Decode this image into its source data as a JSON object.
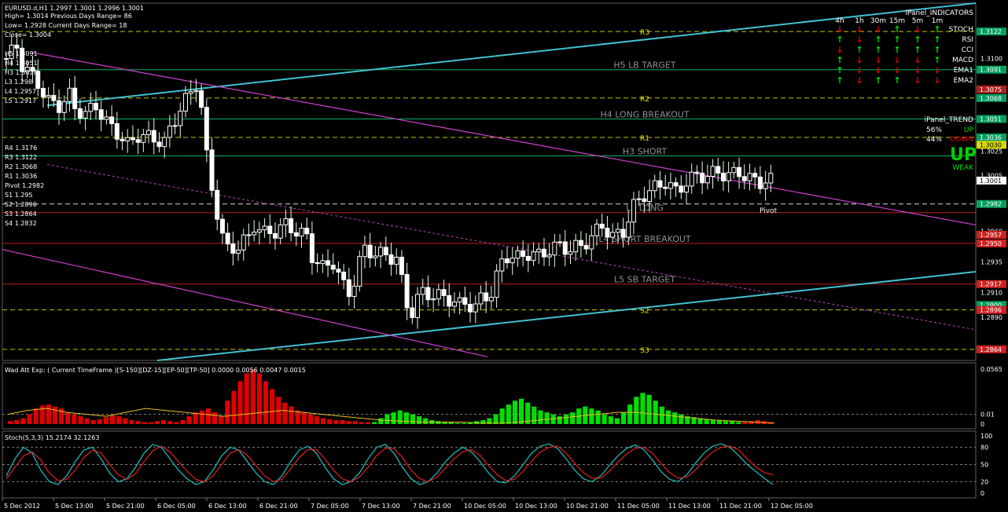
{
  "chart_data": [
    {
      "type": "candlestick",
      "symbol_line": "EURUSD.d,H1  1.2997 1.3001 1.2996 1.3001",
      "info_lines": [
        "High= 1.3014    Previous Days Range= 86",
        "Low= 1.2928    Current Days Range= 18",
        "Close= 1.3004"
      ],
      "ylim": [
        1.2855,
        1.3145
      ],
      "y_ticks": [
        "1.3122",
        "1.3100",
        "1.3075",
        "1.3051",
        "1.3025",
        "1.3005",
        "1.3001",
        "1.2960",
        "1.2935",
        "1.2910",
        "1.2890",
        "1.2864"
      ],
      "close_path": [
        [
          0,
          1.31
        ],
        [
          2,
          1.311
        ],
        [
          3,
          1.3095
        ],
        [
          6,
          1.308
        ],
        [
          8,
          1.3065
        ],
        [
          10,
          1.3062
        ],
        [
          12,
          1.307
        ],
        [
          13,
          1.306
        ],
        [
          15,
          1.3055
        ],
        [
          17,
          1.3062
        ],
        [
          19,
          1.3048
        ],
        [
          21,
          1.304
        ],
        [
          23,
          1.303
        ],
        [
          25,
          1.3038
        ],
        [
          28,
          1.3035
        ],
        [
          30,
          1.3032
        ],
        [
          33,
          1.306
        ],
        [
          35,
          1.3072
        ],
        [
          36,
          1.308
        ],
        [
          37,
          1.306
        ],
        [
          38,
          1.302
        ],
        [
          39,
          1.2995
        ],
        [
          40,
          1.2975
        ],
        [
          41,
          1.2955
        ],
        [
          42,
          1.2945
        ],
        [
          44,
          1.2948
        ],
        [
          46,
          1.2955
        ],
        [
          47,
          1.2965
        ],
        [
          49,
          1.2958
        ],
        [
          51,
          1.296
        ],
        [
          53,
          1.2965
        ],
        [
          55,
          1.296
        ],
        [
          57,
          1.2955
        ],
        [
          58,
          1.294
        ],
        [
          60,
          1.293
        ],
        [
          62,
          1.2935
        ],
        [
          63,
          1.2925
        ],
        [
          64,
          1.2915
        ],
        [
          65,
          1.291
        ],
        [
          66,
          1.292
        ],
        [
          67,
          1.2935
        ],
        [
          68,
          1.2945
        ],
        [
          70,
          1.2942
        ],
        [
          72,
          1.294
        ],
        [
          74,
          1.2938
        ],
        [
          76,
          1.29
        ],
        [
          77,
          1.2895
        ],
        [
          78,
          1.2905
        ],
        [
          79,
          1.291
        ],
        [
          81,
          1.2908
        ],
        [
          84,
          1.2905
        ],
        [
          86,
          1.29
        ],
        [
          87,
          1.2902
        ],
        [
          89,
          1.2898
        ],
        [
          90,
          1.2905
        ],
        [
          92,
          1.291
        ],
        [
          94,
          1.2935
        ],
        [
          95,
          1.294
        ],
        [
          97,
          1.2938
        ],
        [
          99,
          1.2942
        ],
        [
          101,
          1.294
        ],
        [
          103,
          1.2945
        ],
        [
          105,
          1.2948
        ],
        [
          107,
          1.2945
        ],
        [
          109,
          1.2948
        ],
        [
          111,
          1.2955
        ],
        [
          113,
          1.2965
        ],
        [
          115,
          1.2955
        ],
        [
          117,
          1.296
        ],
        [
          119,
          1.298
        ],
        [
          121,
          1.299
        ],
        [
          123,
          1.2995
        ],
        [
          125,
          1.3
        ],
        [
          127,
          1.2992
        ],
        [
          129,
          1.3
        ],
        [
          131,
          1.3005
        ],
        [
          133,
          1.3005
        ],
        [
          135,
          1.3008
        ],
        [
          137,
          1.3005
        ],
        [
          139,
          1.3008
        ],
        [
          141,
          1.3002
        ],
        [
          143,
          1.3
        ],
        [
          145,
          1.3001
        ]
      ],
      "levels": [
        {
          "label": "H5 LB TARGET",
          "value": 1.3091,
          "color": "#00d070"
        },
        {
          "label": "R2",
          "value": 1.3068,
          "color": "#e8e800"
        },
        {
          "label": "H4 LONG BREAKOUT",
          "value": 1.3051,
          "color": "#00d070"
        },
        {
          "label": "R1",
          "value": 1.3036,
          "color": "#e8e800"
        },
        {
          "label": "H3 SHORT",
          "value": 1.3021,
          "color": "#00d070"
        },
        {
          "label": "Pivot",
          "value": 1.2982,
          "color": "#ffffff"
        },
        {
          "label": "L3 LONG",
          "value": 1.2975,
          "color": "#e02020"
        },
        {
          "label": "L4 SHORT BREAKOUT",
          "value": 1.295,
          "color": "#e02020"
        },
        {
          "label": "L5 SB TARGET",
          "value": 1.2917,
          "color": "#e02020"
        },
        {
          "label": "S2",
          "value": 1.2896,
          "color": "#e8e800"
        },
        {
          "label": "R3",
          "value": 1.3122,
          "color": "#e8e800"
        },
        {
          "label": "S3",
          "value": 1.2864,
          "color": "#e8e800"
        }
      ],
      "left_levels": [
        "H5 1.3091",
        "H4 1.3051",
        "H3 1.3028",
        "L3 1.298",
        "L4 1.2957",
        "L5 1.2917",
        "R4 1.3176",
        "R3 1.3122",
        "R2 1.3068",
        "R1 1.3036",
        "Pivot 1.2982",
        "S1 1.295",
        "S2 1.2896",
        "S3 1.2864",
        "S4 1.2832"
      ],
      "price_tags": [
        {
          "text": "1.3122",
          "bg": "#00a060"
        },
        {
          "text": "1.3091",
          "bg": "#00a060"
        },
        {
          "text": "1.3075",
          "bg": "#b02020"
        },
        {
          "text": "1.3068",
          "bg": "#00a060"
        },
        {
          "text": "1.3051",
          "bg": "#00a060"
        },
        {
          "text": "1.3036",
          "bg": "#00a060"
        },
        {
          "text": "1.3030",
          "bg": "#d8d800"
        },
        {
          "text": "1.3001",
          "bg": "#ffffff"
        },
        {
          "text": "1.2982",
          "bg": "#00a060"
        },
        {
          "text": "1.2957",
          "bg": "#d02020"
        },
        {
          "text": "1.2950",
          "bg": "#d02020"
        },
        {
          "text": "1.2917",
          "bg": "#d02020"
        },
        {
          "text": "1.2900",
          "bg": "#00a060"
        },
        {
          "text": "1.2896",
          "bg": "#d02020"
        },
        {
          "text": "1.2864",
          "bg": "#d02020"
        }
      ],
      "x_ticks": [
        "5 Dec 2012",
        "5 Dec 13:00",
        "5 Dec 21:00",
        "6 Dec 05:00",
        "6 Dec 13:00",
        "6 Dec 21:00",
        "7 Dec 05:00",
        "7 Dec 13:00",
        "7 Dec 21:00",
        "10 Dec 05:00",
        "10 Dec 13:00",
        "10 Dec 21:00",
        "11 Dec 05:00",
        "11 Dec 13:00",
        "11 Dec 21:00",
        "12 Dec 05:00"
      ],
      "pivot_label": "Pivot"
    },
    {
      "type": "bar",
      "title": "Wad Att Exp: ( Current TimeFrame )[S-150][DZ-15][EP-50][TP-50] 0.0000 0.0056 0.0047 0.0015",
      "y_ticks": [
        "0.0565",
        "0.01",
        "0"
      ],
      "ylim": [
        0,
        0.0565
      ],
      "values": [
        -0.003,
        -0.004,
        -0.006,
        -0.01,
        -0.016,
        -0.019,
        -0.02,
        -0.018,
        -0.016,
        -0.012,
        -0.01,
        -0.008,
        -0.006,
        -0.004,
        -0.005,
        -0.007,
        -0.009,
        -0.008,
        -0.006,
        -0.004,
        -0.003,
        -0.002,
        -0.002,
        -0.003,
        -0.004,
        -0.003,
        -0.002,
        -0.004,
        -0.008,
        -0.012,
        -0.014,
        -0.016,
        -0.012,
        -0.008,
        -0.024,
        -0.034,
        -0.044,
        -0.052,
        -0.056,
        -0.052,
        -0.044,
        -0.036,
        -0.028,
        -0.022,
        -0.018,
        -0.014,
        -0.012,
        -0.01,
        -0.008,
        -0.006,
        -0.005,
        -0.004,
        -0.004,
        -0.003,
        -0.003,
        -0.002,
        -0.002,
        0.002,
        0.006,
        0.01,
        0.012,
        0.014,
        0.012,
        0.01,
        0.008,
        0.006,
        0.004,
        0.003,
        0.002,
        0.002,
        0.001,
        0.001,
        0.002,
        0.003,
        0.004,
        0.006,
        0.01,
        0.016,
        0.02,
        0.024,
        0.026,
        0.022,
        0.018,
        0.014,
        0.012,
        0.01,
        0.008,
        0.01,
        0.012,
        0.016,
        0.018,
        0.016,
        0.014,
        0.01,
        0.008,
        0.006,
        0.012,
        0.02,
        0.028,
        0.032,
        0.03,
        0.024,
        0.018,
        0.014,
        0.012,
        0.01,
        0.008,
        0.007,
        0.006,
        0.005,
        0.004,
        0.004,
        0.003,
        0.003,
        0.002,
        -0.002,
        -0.003,
        -0.004,
        -0.003,
        -0.002
      ],
      "signal_line": [
        0.01,
        0.014,
        0.016,
        0.012,
        0.01,
        0.008,
        0.012,
        0.016,
        0.014,
        0.012,
        0.01,
        0.008,
        0.01,
        0.012,
        0.014,
        0.012,
        0.01,
        0.008,
        0.006,
        0.004,
        0.003,
        0.002,
        0.002,
        0.002,
        0.001,
        0.001,
        0.002,
        0.004,
        0.006,
        0.008,
        0.01,
        0.012,
        0.012,
        0.01,
        0.008,
        0.006,
        0.004,
        0.003,
        0.002,
        0.001
      ]
    },
    {
      "type": "line",
      "title": "Stoch(5,3,3) 15.2174 32.1263",
      "y_ticks": [
        "100",
        "80",
        "50",
        "20",
        "0"
      ],
      "ylim": [
        0,
        100
      ],
      "series": [
        {
          "color": "#20c0c0",
          "values": [
            30,
            60,
            80,
            70,
            40,
            20,
            15,
            30,
            55,
            75,
            80,
            60,
            35,
            20,
            25,
            45,
            70,
            85,
            80,
            60,
            40,
            25,
            15,
            20,
            40,
            65,
            80,
            75,
            55,
            35,
            20,
            15,
            30,
            55,
            75,
            82,
            70,
            45,
            25,
            15,
            20,
            35,
            60,
            80,
            85,
            70,
            45,
            25,
            15,
            20,
            35,
            55,
            70,
            80,
            72,
            55,
            35,
            20,
            18,
            30,
            50,
            70,
            82,
            86,
            78,
            60,
            40,
            25,
            20,
            30,
            48,
            65,
            78,
            84,
            76,
            58,
            38,
            24,
            20,
            32,
            52,
            70,
            82,
            86,
            80,
            66,
            50,
            38,
            26,
            15
          ]
        },
        {
          "color": "#e02020",
          "values": [
            25,
            45,
            65,
            72,
            58,
            35,
            22,
            24,
            40,
            62,
            75,
            70,
            50,
            32,
            24,
            34,
            55,
            74,
            82,
            72,
            55,
            38,
            24,
            20,
            30,
            50,
            70,
            76,
            66,
            48,
            30,
            20,
            24,
            42,
            62,
            76,
            76,
            60,
            40,
            25,
            20,
            28,
            45,
            66,
            78,
            78,
            62,
            40,
            25,
            20,
            28,
            44,
            60,
            72,
            76,
            66,
            48,
            32,
            22,
            24,
            38,
            56,
            72,
            80,
            82,
            70,
            52,
            36,
            26,
            26,
            38,
            54,
            68,
            78,
            80,
            70,
            52,
            36,
            26,
            28,
            40,
            58,
            72,
            80,
            82,
            76,
            60,
            46,
            36,
            32
          ]
        }
      ]
    }
  ],
  "panel_indicators": {
    "title": "iPanel_INDICATORS",
    "timeframes": [
      "4h",
      "1h",
      "30m",
      "15m",
      "5m",
      "1m"
    ],
    "rows": [
      {
        "name": "STOCH",
        "arrows": [
          "down",
          "down",
          "down",
          "up",
          "down",
          "up"
        ]
      },
      {
        "name": "RSI",
        "arrows": [
          "up",
          "down",
          "up",
          "up",
          "up",
          "up"
        ]
      },
      {
        "name": "CCI",
        "arrows": [
          "down",
          "up",
          "up",
          "up",
          "up",
          "up"
        ]
      },
      {
        "name": "MACD",
        "arrows": [
          "up",
          "down",
          "down",
          "down",
          "down",
          "up"
        ]
      },
      {
        "name": "EMA1",
        "arrows": [
          "up",
          "down",
          "down",
          "down",
          "down",
          "down"
        ]
      },
      {
        "name": "EMA2",
        "arrows": [
          "up",
          "down",
          "up",
          "up",
          "down",
          "down"
        ]
      }
    ]
  },
  "panel_trend": {
    "title": "iPanel_TREND",
    "up_pct": "56%",
    "up_label": "UP",
    "down_pct": "44%",
    "down_label": "DOWN",
    "big_word": "UP",
    "strength": "WEAK"
  },
  "colors": {
    "up": "#00e000",
    "down": "#e00000",
    "grid": "#808080"
  }
}
